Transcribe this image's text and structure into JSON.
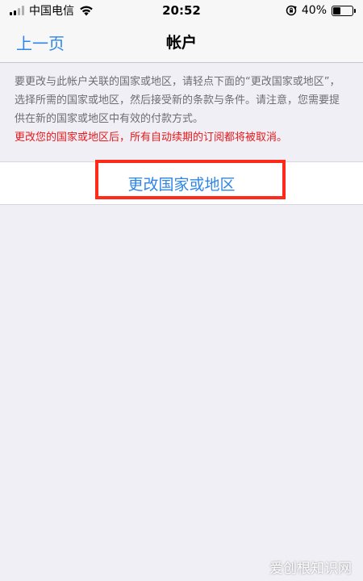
{
  "status_bar": {
    "carrier": "中国电信",
    "time": "20:52",
    "battery_percent": "40%",
    "battery_level": 0.4,
    "icons": [
      "signal-icon",
      "wifi-icon",
      "rotation-lock-icon",
      "battery-icon"
    ]
  },
  "nav": {
    "back_label": "上一页",
    "title": "帐户"
  },
  "description": {
    "text": "要更改与此帐户关联的国家或地区，请轻点下面的“更改国家或地区”，选择所需的国家或地区，然后接受新的条款与条件。请注意，您需要提供在新的国家或地区中有效的付款方式。",
    "warning": "更改您的国家或地区后，所有自动续期的订阅都将被取消。"
  },
  "action": {
    "label": "更改国家或地区"
  },
  "watermark": {
    "text": "爱创根知识网"
  },
  "colors": {
    "link": "#2f86e8",
    "warning": "#e8191b",
    "highlight": "#ff2a1a",
    "background": "#f0eff5"
  }
}
